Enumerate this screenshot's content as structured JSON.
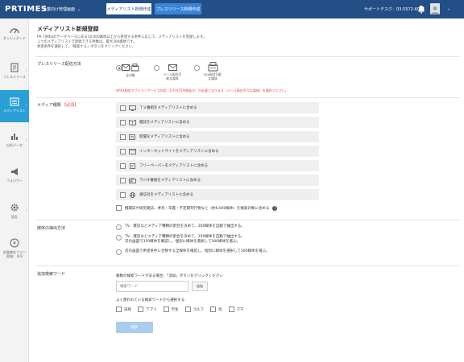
{
  "header": {
    "logo": "PRTIMES",
    "company": "企業向け管理画面",
    "btn_media_list": "メディアリスト新規作成",
    "btn_new_release": "プレスリリース新規作成",
    "support": "サポートデスク：03-5572-6076"
  },
  "sidebar": {
    "items": [
      {
        "label": "ダッシュボード",
        "icon": "dashboard-icon"
      },
      {
        "label": "プレスリリース",
        "icon": "document-icon"
      },
      {
        "label": "メディアリスト",
        "icon": "list-icon"
      },
      {
        "label": "分析データ",
        "icon": "bar-chart-icon"
      },
      {
        "label": "フォロワー",
        "icon": "megaphone-icon"
      },
      {
        "label": "設定",
        "icon": "gear-icon"
      },
      {
        "label": "従量課金プラン（税抜：0円）",
        "icon": "yen-icon"
      }
    ]
  },
  "main": {
    "title": "メディアリスト新規登録",
    "desc": [
      "PR TIMESのデータベースにある10,000媒体以上から希望する条件に応じて、メディアリストを登録します。",
      "１つのメディアリストで登録できる件数は、最大300媒体です。",
      "希望条件を選択して、「検索する」ボタンをクリックください。"
    ],
    "distribution": {
      "label": "プレスリリース配信方法",
      "options": [
        {
          "caption": "全対象",
          "checked": true
        },
        {
          "caption": "メール配信可能な媒体",
          "checked": false
        },
        {
          "caption": "FAX配信可能な媒体",
          "checked": false
        }
      ],
      "note": "※FAX配信オプションサービス利用（5千円/月※税抜き）が必要となります（メール配信不可な媒体）を選択ください。"
    },
    "media_type": {
      "label": "メディア種類",
      "required": "【必須】",
      "rows": [
        "ＴＶ番組をメディアリストに含める",
        "雑誌をメディアリストに含める",
        "新聞をメディアリストに含める",
        "インターネットサイトをメディアリストに含める",
        "フリーペーパーをメディアリストに含める",
        "ラジオ番組をメディアリストに含める",
        "通信社をメディアリストに含める"
      ],
      "extra": "機関誌や研究雑誌、季刊・年鑑・不定期刊行物など（約6,000媒体）を検索対象に含める"
    },
    "extraction": {
      "label": "媒体の抽出方法",
      "options": [
        [
          "TV、雑誌などメディア種類の割合を決めて、300媒体を自動で抽出する。"
        ],
        [
          "TV、雑誌などメディア種類の割合を決めて、350媒体を自動で抽出する。",
          "次の画面で350媒体を確認し、個別に媒体を選択して300媒体を選ぶ。"
        ],
        [
          "次の画面で希望条件に合致する全媒体を確認し、個別に媒体を選択して300媒体を選ぶ。"
        ]
      ]
    },
    "keywords": {
      "label": "追加検索ワード",
      "note": "複数の検索ワードがある場合、「追加」ボタンをクリックください",
      "placeholder": "検索ワード",
      "add": "追加",
      "common_label": "よく使われている検索ワードから選択する",
      "tags": [
        "日経",
        "アプリ",
        "学生",
        "ゴルフ",
        "母",
        "ママ"
      ]
    },
    "search_button": "検索"
  },
  "colors": {
    "header_bg": "#234e86",
    "accent": "#2a9fd6",
    "required": "#e0443e",
    "search_btn": "#a9cdee"
  }
}
